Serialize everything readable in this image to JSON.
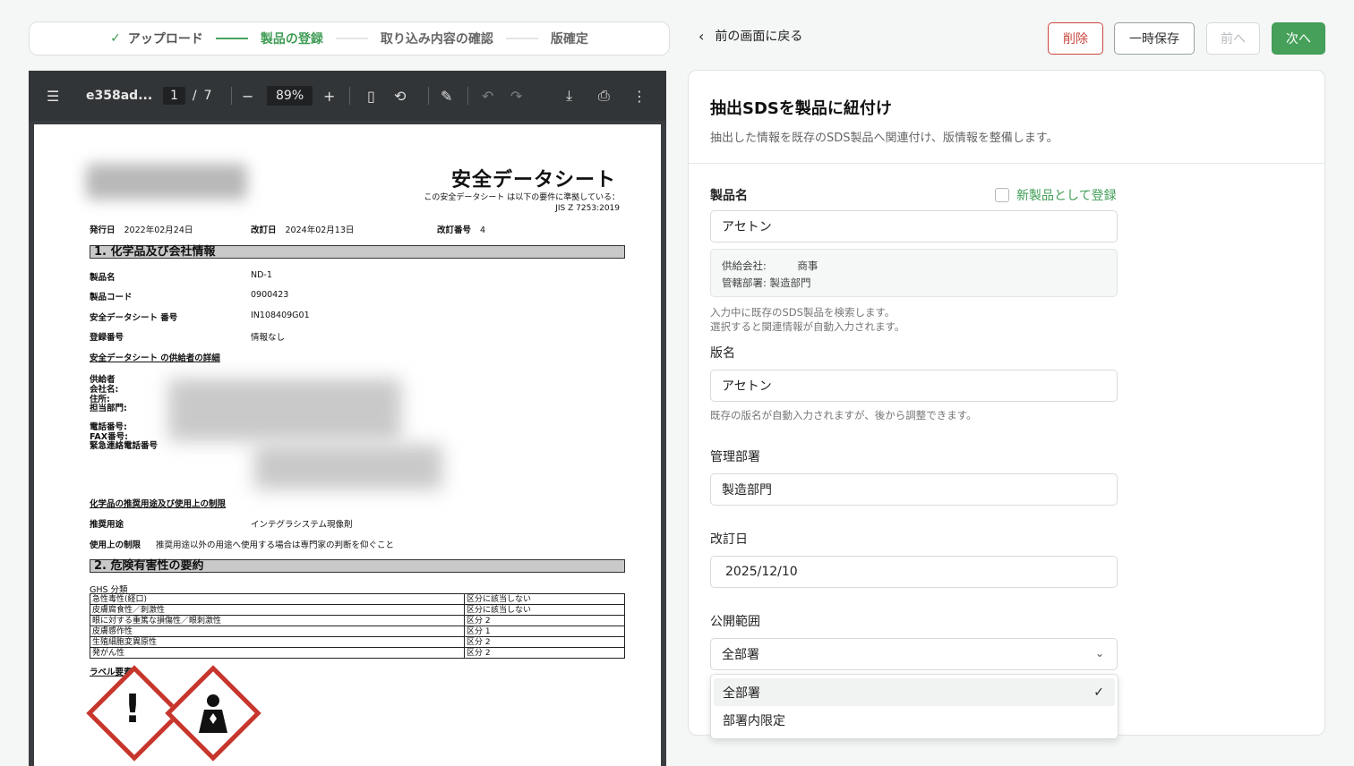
{
  "stepper": {
    "steps": [
      {
        "label": "アップロード",
        "state": "done"
      },
      {
        "label": "製品の登録",
        "state": "active"
      },
      {
        "label": "取り込み内容の確認",
        "state": "pending"
      },
      {
        "label": "版確定",
        "state": "pending"
      }
    ]
  },
  "header": {
    "back_label": "前の画面に戻る",
    "delete_label": "削除",
    "save_label": "一時保存",
    "prev_label": "前へ",
    "next_label": "次へ"
  },
  "viewer": {
    "filename": "e358ad...",
    "page_current": "1",
    "page_total": "7",
    "zoom": "89%"
  },
  "pdf": {
    "title": "安全データシート",
    "subtitle_1": "この安全データシート は以下の要件に準拠している：",
    "subtitle_2": "JIS Z 7253:2019",
    "issue_label": "発行日",
    "issue_date": "2022年02月24日",
    "revise_label": "改訂日",
    "revise_date": "2024年02月13日",
    "revno_label": "改訂番号",
    "revno": "4",
    "section1": "1. 化学品及び会社情報",
    "product_name_k": "製品名",
    "product_name_v": "ND-1",
    "product_code_k": "製品コード",
    "product_code_v": "0900423",
    "sds_no_k": "安全データシート 番号",
    "sds_no_v": "IN108409G01",
    "reg_no_k": "登録番号",
    "reg_no_v": "情報なし",
    "supplier_detail": "安全データシート の供給者の詳細",
    "supplier_k": "供給者",
    "company_k": "会社名:",
    "address_k": "住所:",
    "dept_k": "担当部門:",
    "tel_k": "電話番号:",
    "fax_k": "FAX番号:",
    "emerg_k": "緊急連絡電話番号",
    "use_heading": "化学品の推奨用途及び使用上の制限",
    "use_k": "推奨用途",
    "use_v": "インテグラシステム現像剤",
    "limit_k": "使用上の制限",
    "limit_v": "推奨用途以外の用途へ使用する場合は専門家の判断を仰ぐこと",
    "section2": "2. 危険有害性の要約",
    "ghs_heading": "GHS 分類",
    "ghs_rows": [
      {
        "hazard": "急性毒性(経口)",
        "cat": "区分に該当しない"
      },
      {
        "hazard": "皮膚腐食性／刺激性",
        "cat": "区分に該当しない"
      },
      {
        "hazard": "眼に対する重篤な損傷性／眼刺激性",
        "cat": "区分 2"
      },
      {
        "hazard": "皮膚感作性",
        "cat": "区分 1"
      },
      {
        "hazard": "生殖細胞変異原性",
        "cat": "区分 2"
      },
      {
        "hazard": "発がん性",
        "cat": "区分 2"
      }
    ],
    "label_heading": "ラベル要素",
    "excl": "!"
  },
  "form": {
    "title": "抽出SDSを製品に紐付け",
    "description": "抽出した情報を既存のSDS製品へ関連付け、版情報を整備します。",
    "product_label": "製品名",
    "new_product_label": "新製品として登録",
    "product_value": "アセトン",
    "supplier_line": "供給会社:　　　商事",
    "dept_line": "管轄部署: 製造部門",
    "product_hint_1": "入力中に既存のSDS製品を検索します。",
    "product_hint_2": "選択すると関連情報が自動入力されます。",
    "version_label": "版名",
    "version_value": "アセトン",
    "version_hint": "既存の版名が自動入力されますが、後から調整できます。",
    "dept_label": "管理部署",
    "dept_value": "製造部門",
    "revdate_label": "改訂日",
    "revdate_value": "2025/12/10",
    "scope_label": "公開範囲",
    "scope_value": "全部署",
    "scope_options": [
      "全部署",
      "部署内限定"
    ]
  }
}
